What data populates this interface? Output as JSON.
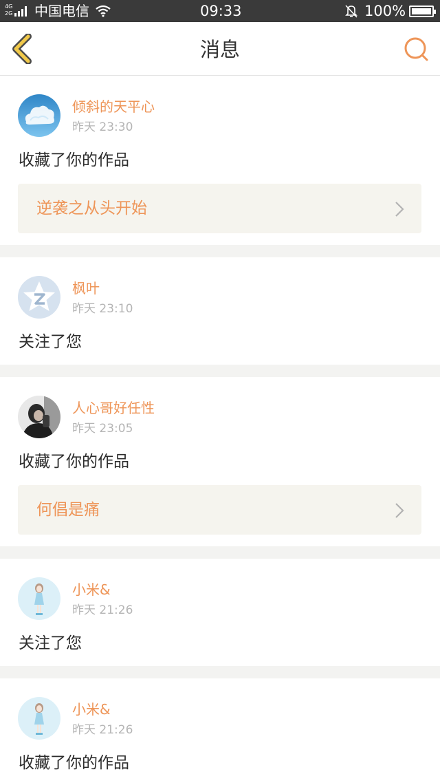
{
  "status_bar": {
    "network_top": "4G",
    "network_bottom": "2G",
    "carrier": "中国电信",
    "time": "09:33",
    "battery": "100%"
  },
  "header": {
    "title": "消息",
    "back_icon": "chevron-left-icon",
    "search_icon": "search-icon"
  },
  "colors": {
    "accent": "#ee9558",
    "back_icon": "#f1c94a",
    "status_bar": "#3a3a3a",
    "work_card_bg": "#f5f4ee"
  },
  "messages": [
    {
      "user": "倾斜的天平心",
      "time": "昨天 23:30",
      "action": "收藏了你的作品",
      "work": "逆袭之从头开始",
      "avatar": "cloud-avatar"
    },
    {
      "user": "枫叶",
      "time": "昨天 23:10",
      "action": "关注了您",
      "avatar": "qq-star-avatar"
    },
    {
      "user": "人心哥好任性",
      "time": "昨天 23:05",
      "action": "收藏了你的作品",
      "work": "何倡是痛",
      "avatar": "photo-avatar"
    },
    {
      "user": "小米&",
      "time": "昨天 21:26",
      "action": "关注了您",
      "avatar": "doll-avatar"
    },
    {
      "user": "小米&",
      "time": "昨天 21:26",
      "action": "收藏了你的作品",
      "avatar": "doll-avatar"
    }
  ]
}
